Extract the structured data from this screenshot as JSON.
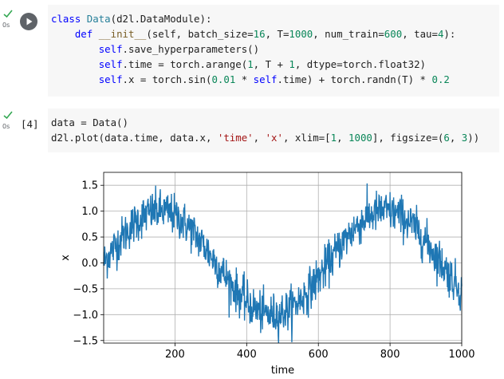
{
  "cell1": {
    "exec_time": "0s",
    "lines": [
      [
        {
          "t": "class ",
          "c": "kw"
        },
        {
          "t": "Data",
          "c": "cls"
        },
        {
          "t": "(d2l.DataModule):",
          "c": ""
        }
      ],
      [
        {
          "t": "    ",
          "c": ""
        },
        {
          "t": "def ",
          "c": "kw"
        },
        {
          "t": "__init__",
          "c": "fn"
        },
        {
          "t": "(self, batch_size=",
          "c": ""
        },
        {
          "t": "16",
          "c": "num"
        },
        {
          "t": ", T=",
          "c": ""
        },
        {
          "t": "1000",
          "c": "num"
        },
        {
          "t": ", num_train=",
          "c": ""
        },
        {
          "t": "600",
          "c": "num"
        },
        {
          "t": ", tau=",
          "c": ""
        },
        {
          "t": "4",
          "c": "num"
        },
        {
          "t": "):",
          "c": ""
        }
      ],
      [
        {
          "t": "        ",
          "c": ""
        },
        {
          "t": "self",
          "c": "self"
        },
        {
          "t": ".save_hyperparameters()",
          "c": ""
        }
      ],
      [
        {
          "t": "        ",
          "c": ""
        },
        {
          "t": "self",
          "c": "self"
        },
        {
          "t": ".time = torch.arange(",
          "c": ""
        },
        {
          "t": "1",
          "c": "num"
        },
        {
          "t": ", T + ",
          "c": ""
        },
        {
          "t": "1",
          "c": "num"
        },
        {
          "t": ", dtype=torch.float32)",
          "c": ""
        }
      ],
      [
        {
          "t": "        ",
          "c": ""
        },
        {
          "t": "self",
          "c": "self"
        },
        {
          "t": ".x = torch.sin(",
          "c": ""
        },
        {
          "t": "0.01",
          "c": "num"
        },
        {
          "t": " * ",
          "c": ""
        },
        {
          "t": "self",
          "c": "self"
        },
        {
          "t": ".time) + torch.randn(T) * ",
          "c": ""
        },
        {
          "t": "0.2",
          "c": "num"
        }
      ]
    ]
  },
  "cell2": {
    "exec_time": "0s",
    "exec_count": "[4]",
    "lines": [
      [
        {
          "t": "data = Data()",
          "c": ""
        }
      ],
      [
        {
          "t": "d2l.plot(data.time, data.x, ",
          "c": ""
        },
        {
          "t": "'time'",
          "c": "str"
        },
        {
          "t": ", ",
          "c": ""
        },
        {
          "t": "'x'",
          "c": "str"
        },
        {
          "t": ", xlim=[",
          "c": ""
        },
        {
          "t": "1",
          "c": "num"
        },
        {
          "t": ", ",
          "c": ""
        },
        {
          "t": "1000",
          "c": "num"
        },
        {
          "t": "], figsize=(",
          "c": ""
        },
        {
          "t": "6",
          "c": "num"
        },
        {
          "t": ", ",
          "c": ""
        },
        {
          "t": "3",
          "c": "num"
        },
        {
          "t": "))",
          "c": ""
        }
      ]
    ]
  },
  "chart_data": {
    "type": "line",
    "title": "",
    "xlabel": "time",
    "ylabel": "x",
    "xlim": [
      1,
      1000
    ],
    "ylim": [
      -1.55,
      1.75
    ],
    "xticks": [
      200,
      400,
      600,
      800,
      1000
    ],
    "yticks": [
      -1.5,
      -1.0,
      -0.5,
      0.0,
      0.5,
      1.0,
      1.5
    ],
    "ytick_labels": [
      "−1.5",
      "−1.0",
      "−0.5",
      "0.0",
      "0.5",
      "1.0",
      "1.5"
    ],
    "xtick_labels": [
      "200",
      "400",
      "600",
      "800",
      "1000"
    ],
    "grid": true,
    "line_color": "#1f77b4",
    "series": [
      {
        "formula": "sin(0.01 * time) + randn * 0.2",
        "x_start": 1,
        "x_end": 1000,
        "n": 1000
      }
    ]
  }
}
